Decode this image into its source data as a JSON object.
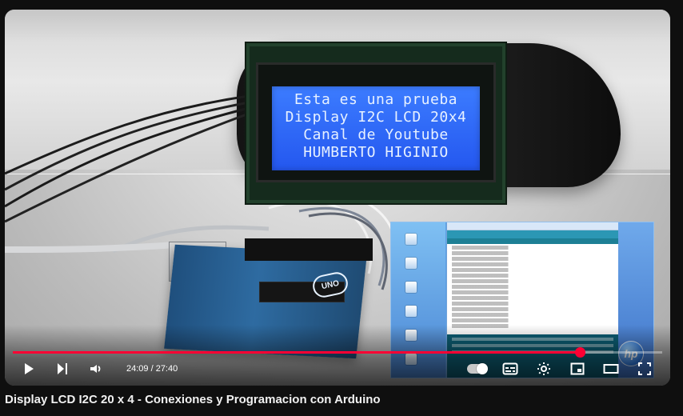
{
  "player": {
    "time_label": "24:09 / 27:40",
    "progress": {
      "value": 0.8729
    }
  },
  "video": {
    "lcd_lines": [
      "Esta es una prueba",
      "Display I2C LCD 20x4",
      "Canal de Youtube",
      "HUMBERTO HIGINIO"
    ],
    "board_label": "UNO",
    "badge_label": "hp"
  },
  "controls": {
    "icons": {
      "play": "play-icon",
      "next": "next-icon",
      "volume": "volume-icon",
      "autoplay": "autoplay-toggle-icon",
      "subtitles": "subtitles-icon",
      "settings": "settings-icon",
      "miniplayer": "miniplayer-icon",
      "theater": "theater-icon",
      "fullscreen": "fullscreen-icon"
    }
  },
  "title": "Display LCD I2C 20 x 4 - Conexiones y Programacion con Arduino",
  "colors": {
    "accent": "#ff0033",
    "background": "#0f0f0f",
    "lcd_blue": "#2f68f6"
  }
}
